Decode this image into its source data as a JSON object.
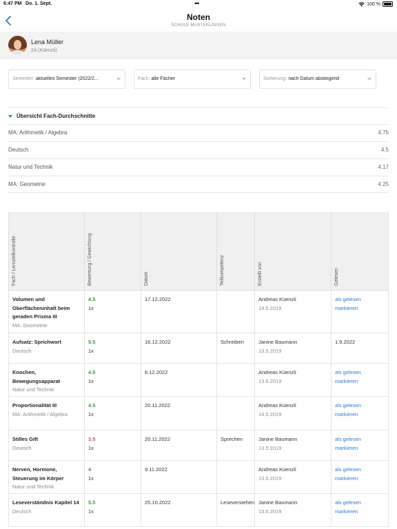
{
  "status_bar": {
    "time": "6:47 PM",
    "date": "Do. 1. Sept.",
    "dots": "•••",
    "battery": "100 %"
  },
  "nav": {
    "title": "Noten",
    "subtitle": "SCHULE MUSTERLINGEN",
    "back_icon": "chevron-left-icon"
  },
  "profile": {
    "name": "Lena Müller",
    "class": "2A (Küenzli)"
  },
  "filters": [
    {
      "label": "Semester:",
      "value": "aktuelles Semester (2022/2..."
    },
    {
      "label": "Fach:",
      "value": "alle Fächer"
    },
    {
      "label": "Sortierung:",
      "value": "nach Datum absteigend"
    }
  ],
  "averages": {
    "title": "Übersicht Fach-Durchschnitte",
    "rows": [
      {
        "subject": "MA: Arithmetik / Algebra",
        "value": "4.75"
      },
      {
        "subject": "Deutsch",
        "value": "4.5"
      },
      {
        "subject": "Natur und Technik",
        "value": "4.17"
      },
      {
        "subject": "MA: Geometrie",
        "value": "4.25"
      }
    ]
  },
  "table": {
    "headers": [
      "Fach / Lernzielkontrolle",
      "Bewertung / Gewichtung",
      "Datum",
      "Teilkompetenz",
      "Erstellt von",
      "Gelesen"
    ],
    "rows": [
      {
        "title": "Volumen und Oberflächeninhalt beim geraden Prisma III",
        "subject": "MA: Geometrie",
        "grade": "4.5",
        "grade_color": "green",
        "weight": "1x",
        "date": "17.12.2022",
        "competence": "",
        "author": "Andreas Küenzli",
        "author_date": "14.5.2019",
        "read": "",
        "read_link": "als gelesen markieren"
      },
      {
        "title": "Aufsatz: Sprichwort",
        "subject": "Deutsch",
        "grade": "5.5",
        "grade_color": "green",
        "weight": "1x",
        "date": "16.12.2022",
        "competence": "Schreiben",
        "author": "Janine Baumann",
        "author_date": "13.5.2019",
        "read": "1.9.2022",
        "read_link": ""
      },
      {
        "title": "Knochen, Bewegungsapparat",
        "subject": "Natur und Technik",
        "grade": "4.5",
        "grade_color": "green",
        "weight": "1x",
        "date": "6.12.2022",
        "competence": "",
        "author": "Andreas Küenzli",
        "author_date": "13.5.2019",
        "read": "",
        "read_link": "als gelesen markieren"
      },
      {
        "title": "Proportionalität III",
        "subject": "MA: Arithmetik / Algebra",
        "grade": "4.5",
        "grade_color": "green",
        "weight": "1x",
        "date": "20.11.2022",
        "competence": "",
        "author": "Andreas Küenzli",
        "author_date": "14.5.2019",
        "read": "",
        "read_link": "als gelesen markieren"
      },
      {
        "title": "Stilles Gift",
        "subject": "Deutsch",
        "grade": "3.5",
        "grade_color": "red",
        "weight": "1x",
        "date": "20.11.2022",
        "competence": "Sprechen",
        "author": "Janine Baumann",
        "author_date": "13.5.2019",
        "read": "",
        "read_link": "als gelesen markieren"
      },
      {
        "title": "Nerven, Hormone, Steuerung im Körper",
        "subject": "Natur und Technik",
        "grade": "4",
        "grade_color": "green",
        "weight": "1x",
        "date": "9.11.2022",
        "competence": "",
        "author": "Andreas Küenzli",
        "author_date": "13.5.2019",
        "read": "",
        "read_link": "als gelesen markieren"
      },
      {
        "title": "Leseverständnis Kapitel 14",
        "subject": "Deutsch",
        "grade": "5.5",
        "grade_color": "green",
        "weight": "1x",
        "date": "25.10.2022",
        "competence": "Leseverstehen",
        "author": "Janine Baumann",
        "author_date": "13.5.2019",
        "read": "",
        "read_link": "als gelesen markieren"
      }
    ]
  },
  "colors": {
    "accent": "#2a7bd0",
    "grade_good": "#3a9a3a",
    "grade_bad": "#d9534f"
  }
}
